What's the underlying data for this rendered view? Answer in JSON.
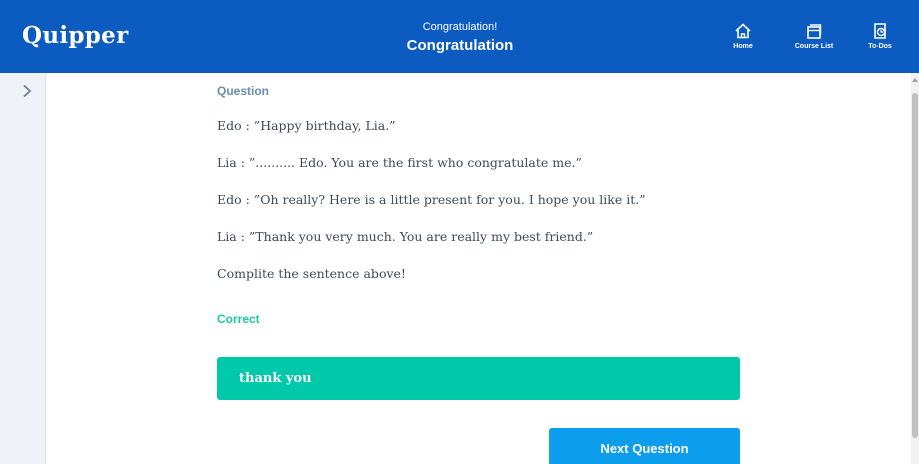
{
  "header": {
    "logo": "Quipper",
    "subtitle": "Congratulation!",
    "title": "Congratulation",
    "nav": [
      {
        "label": "Home",
        "icon": "home-icon"
      },
      {
        "label": "Course List",
        "icon": "course-list-icon"
      },
      {
        "label": "To-Dos",
        "icon": "todos-icon"
      }
    ],
    "background": "#0b5bc0"
  },
  "question": {
    "label": "Question",
    "lines": [
      "Edo : ”Happy birthday, Lia.”",
      "Lia : ”.......... Edo. You are the first who congratulate me.”",
      "Edo : ”Oh really? Here is a little present for you. I hope you like it.”",
      "Lia : ”Thank you very much. You are really my best friend.”",
      "Complite the sentence above!"
    ]
  },
  "result": {
    "label": "Correct",
    "answer": "thank you",
    "answer_color": "#00c9aa"
  },
  "actions": {
    "next_label": "Next Question",
    "next_color": "#0c9ded"
  },
  "sidebar": {
    "toggle_icon": "chevron-right-icon"
  }
}
